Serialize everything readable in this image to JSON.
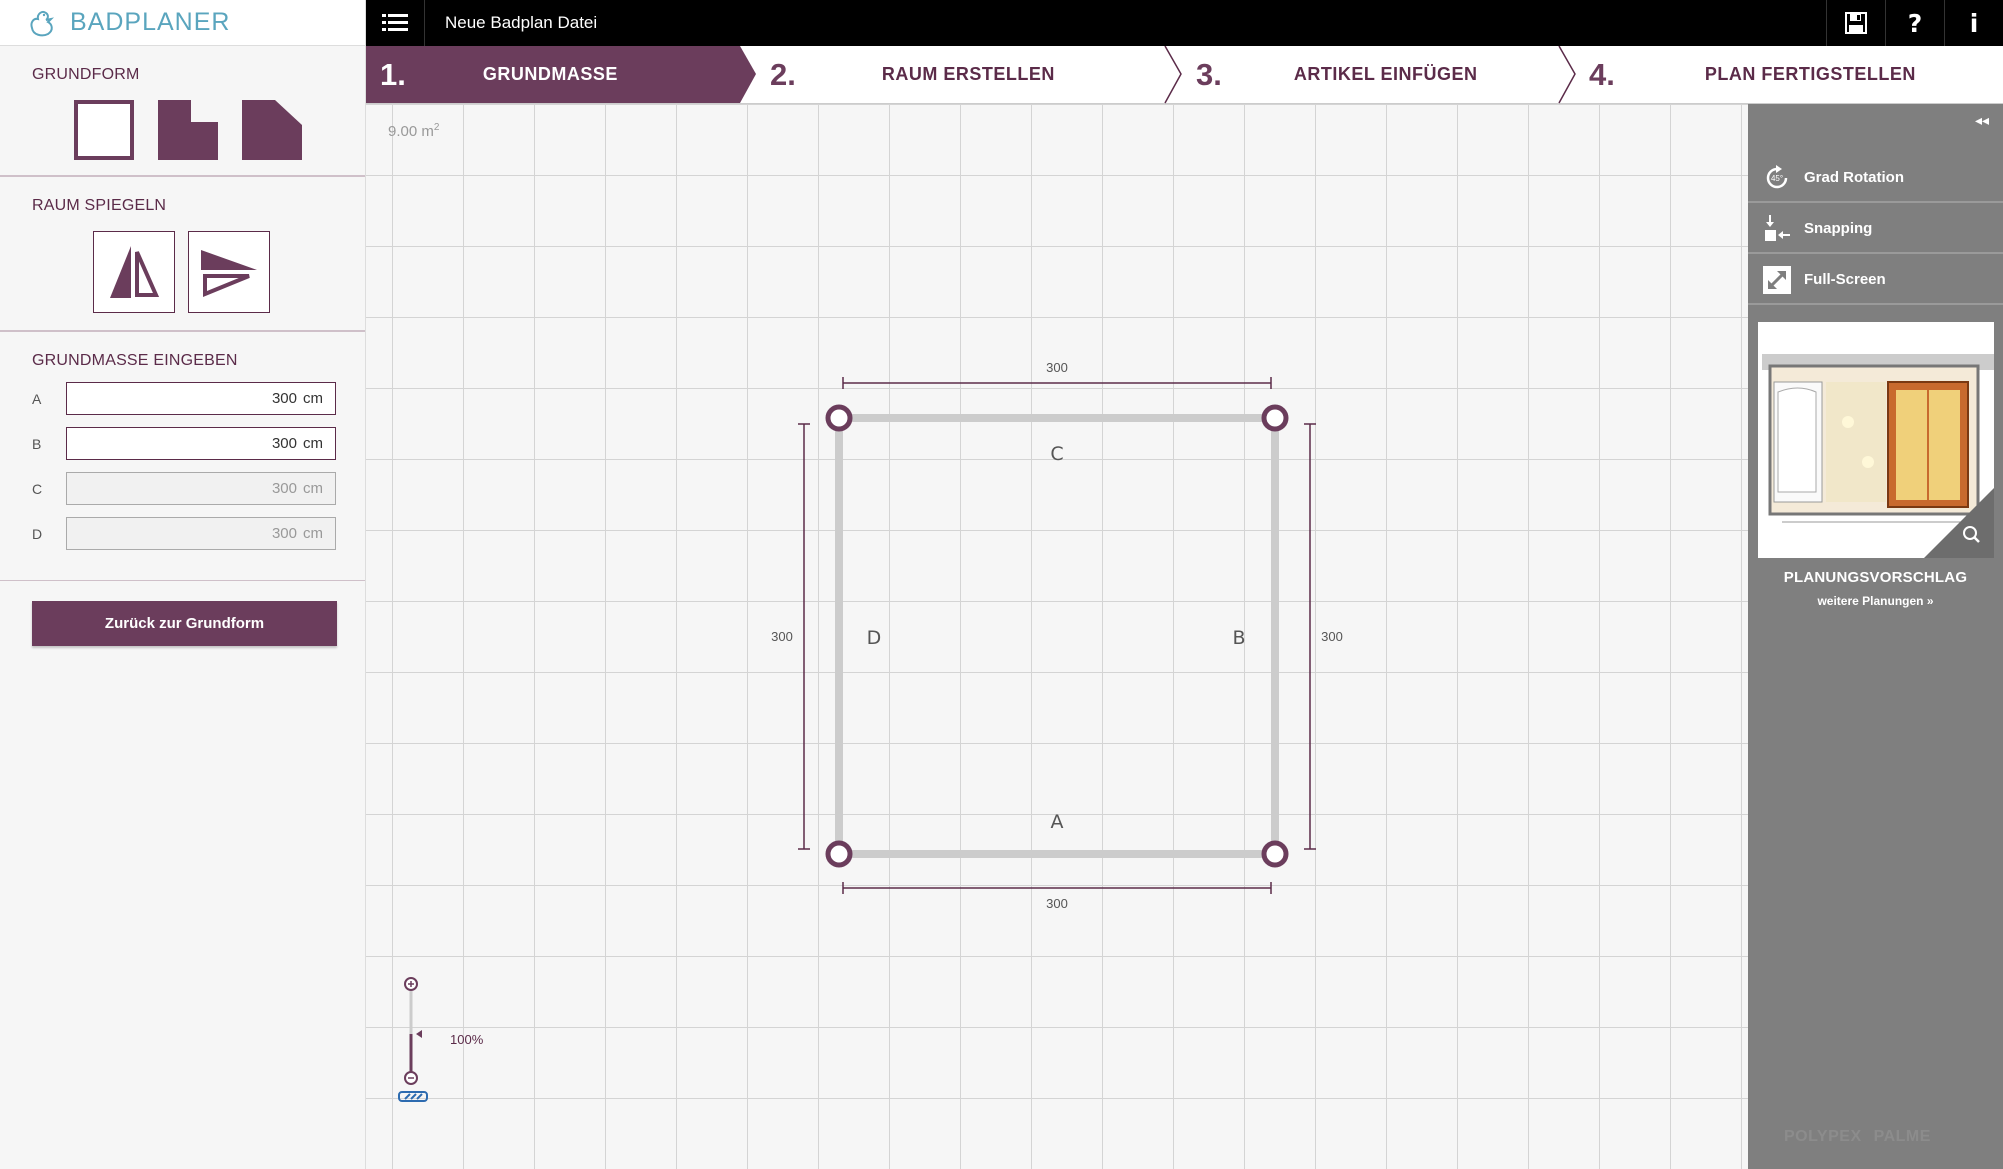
{
  "brand": {
    "name": "BADPLANER",
    "logo_icon": "duck-icon",
    "color": "#5aa5be"
  },
  "sidebar": {
    "shape_title": "GRUNDFORM",
    "shapes": [
      "square-shape-icon",
      "l-shape-icon",
      "cut-corner-shape-icon"
    ],
    "mirror_title": "RAUM SPIEGELN",
    "mirror_buttons": [
      "mirror-vertical-icon",
      "mirror-horizontal-icon"
    ],
    "dims_title": "GRUNDMASSE EINGEBEN",
    "dims": [
      {
        "label": "A",
        "value": "300",
        "unit": "cm",
        "enabled": true
      },
      {
        "label": "B",
        "value": "300",
        "unit": "cm",
        "enabled": true
      },
      {
        "label": "C",
        "value": "300",
        "unit": "cm",
        "enabled": false
      },
      {
        "label": "D",
        "value": "300",
        "unit": "cm",
        "enabled": false
      }
    ],
    "back_button": "Zurück zur Grundform"
  },
  "topbar": {
    "menu_icon": "list-menu-icon",
    "file_title": "Neue Badplan Datei",
    "actions": [
      "save-icon",
      "help-icon",
      "info-icon"
    ],
    "help_label": "?",
    "info_label": "i"
  },
  "steps": [
    {
      "num": "1.",
      "label": "GRUNDMASSE",
      "active": true
    },
    {
      "num": "2.",
      "label": "RAUM ERSTELLEN",
      "active": false
    },
    {
      "num": "3.",
      "label": "ARTIKEL EINFÜGEN",
      "active": false
    },
    {
      "num": "4.",
      "label": "PLAN FERTIGSTELLEN",
      "active": false
    }
  ],
  "canvas": {
    "area_value": "9.00 m",
    "area_sup": "2",
    "room": {
      "wall_labels": {
        "top": "C",
        "right": "B",
        "bottom": "A",
        "left": "D"
      },
      "dim_top": "300",
      "dim_bottom": "300",
      "dim_left": "300",
      "dim_right": "300"
    },
    "zoom_label": "100%",
    "zoom_level": 1.0
  },
  "rightpanel": {
    "collapse_label": "◂◂",
    "tools": [
      {
        "icon": "rotation-45-icon",
        "label": "Grad Rotation",
        "badge": "45°"
      },
      {
        "icon": "snapping-icon",
        "label": "Snapping"
      },
      {
        "icon": "fullscreen-icon",
        "label": "Full-Screen"
      }
    ],
    "proposal_title": "PLANUNGSVORSCHLAG",
    "proposal_link": "weitere Planungen »",
    "footer_logos": [
      "POLYPEX",
      "PALME"
    ]
  },
  "colors": {
    "accent": "#6b3d5c",
    "accent_dark": "#5b2b49",
    "panel_gray": "#7f7f7f"
  }
}
